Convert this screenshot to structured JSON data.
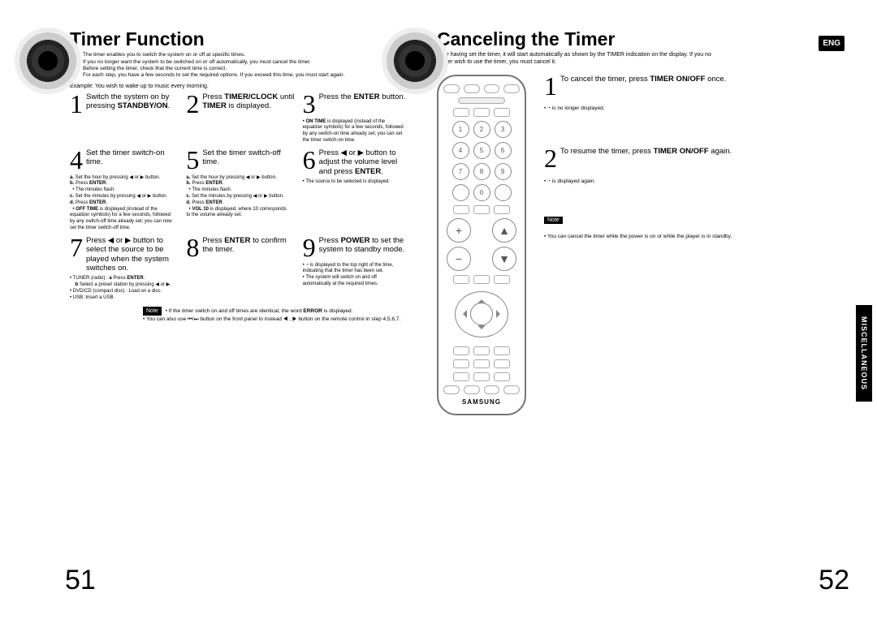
{
  "left": {
    "title": "Timer Function",
    "intro_lines": [
      "The timer enables you to switch the system on or off at specific times.",
      "If you no longer want the system to be switched on or off automatically, you must cancel the timer.",
      "Before setting the timer, check that the current time is correct.",
      "For each step, you have a few seconds to set the required options. If you exceed this time, you must start again."
    ],
    "example": "Example: You wish to wake up to music every morning.",
    "steps": [
      {
        "num": "1",
        "text": "Switch the system on by pressing <b>STANDBY/ON</b>."
      },
      {
        "num": "2",
        "text": "Press <b>TIMER/CLOCK</b> until <b>TIMER</b> is displayed."
      },
      {
        "num": "3",
        "text": "Press the <b>ENTER</b> button.",
        "notes": "• <b>ON TIME</b> is displayed (instead of the equalizer symbols) for a few seconds, followed by any switch-on time already set; you can set the timer switch-on time."
      },
      {
        "num": "4",
        "text": "Set the timer switch-on time.",
        "notes": "<b>a.</b> Set the hour by pressing ◀ or ▶ button.<br><b>b.</b> Press <b>ENTER</b>.<br>&nbsp;&nbsp;• The minutes flash.<br><b>c.</b> Set the minutes by pressing ◀ or ▶ button.<br><b>d.</b> Press <b>ENTER</b>.<br>&nbsp;&nbsp;• <b>OFF TIME</b> is displayed (instead of the equalizer symbols) for a few seconds, followed by any switch-off time already set; you can now set the timer switch-off time."
      },
      {
        "num": "5",
        "text": "Set the timer switch-off time.",
        "notes": "<b>a.</b> Set the hour by pressing ◀ or ▶ button.<br><b>b.</b> Press <b>ENTER</b>.<br>&nbsp;&nbsp;• The minutes flash.<br><b>c.</b> Set the minutes by pressing ◀ or ▶ button.<br><b>d.</b> Press <b>ENTER</b>.<br>&nbsp;&nbsp;• <b>VOL 10</b> is displayed, where 10 corresponds to the volume already set."
      },
      {
        "num": "6",
        "text": "Press ◀ or ▶ button to adjust the volume level and press <b>ENTER</b>.",
        "notes": "• The source to be selected is displayed."
      },
      {
        "num": "7",
        "text": "Press ◀ or ▶ button to select the source to be played when the system switches on.",
        "notes": "• TUNER (radio) : <b>a</b> Press <b>ENTER</b>.<br>&nbsp;&nbsp;&nbsp;&nbsp;<b>b</b> Select a preset station by pressing ◀ or ▶.<br>• DVD/CD (compact disc) : Load on a disc.<br>• USB :Insert a USB."
      },
      {
        "num": "8",
        "text": "Press <b>ENTER</b> to confirm the timer."
      },
      {
        "num": "9",
        "text": "Press <b>POWER</b> to set the system to standby mode.",
        "notes": "• ◔ is displayed to the top right of the time, indicating that the timer has been set.<br>• The system will switch on and off automatically at the required times."
      }
    ],
    "bottom": {
      "note_label": "Note",
      "lines": [
        "If the timer switch on and off times are identical, the word <b>ERROR</b> is displayed.",
        "You can also use ⏮/⏭ button on the front panel to instead ◀ , ▶ button on the remote control in step 4,5,6,7."
      ]
    },
    "page_num": "51"
  },
  "right": {
    "title": "Canceling the Timer",
    "eng": "ENG",
    "intro": "After having set the timer, it will start automatically as shown by the TIMER indication on the display. If you no longer wish to use the timer, you must cancel it.",
    "steps": [
      {
        "num": "1",
        "text": "To cancel the timer, press <b>TIMER ON/OFF</b> once.",
        "notes": "• ◔ is no longer displayed."
      },
      {
        "num": "2",
        "text": "To resume the timer, press <b>TIMER ON/OFF</b> again.",
        "notes": "• ◔ is displayed again."
      }
    ],
    "note_label": "Note",
    "note_line": "You can cancel the timer while the power is on or while the player is in standby.",
    "page_num": "52",
    "misc_tab": "MISCELLANEOUS",
    "brand": "SAMSUNG"
  },
  "numpad": [
    "1",
    "2",
    "3",
    "4",
    "5",
    "6",
    "7",
    "8",
    "9",
    "0"
  ]
}
